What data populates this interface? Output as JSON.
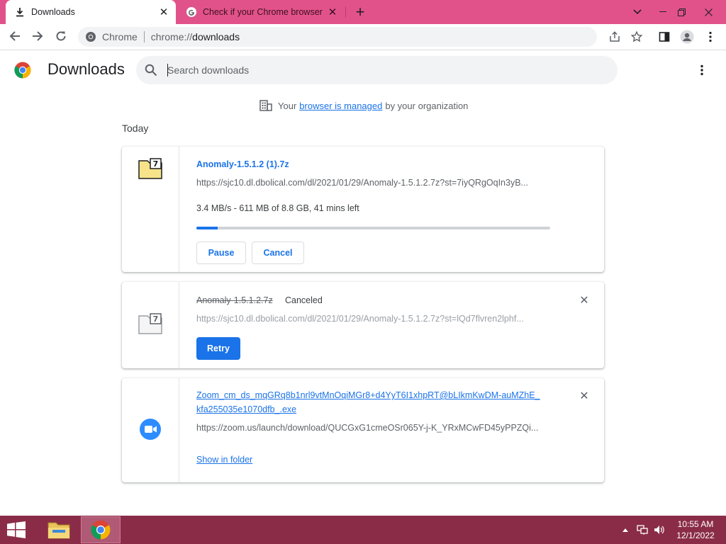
{
  "tabs": [
    {
      "title": "Downloads",
      "icon": "download-icon",
      "active": true
    },
    {
      "title": "Check if your Chrome browser is",
      "icon": "google-icon",
      "active": false
    }
  ],
  "toolbar": {
    "scheme_label": "Chrome",
    "url_prefix": "chrome://",
    "url_host": "downloads"
  },
  "header": {
    "title": "Downloads",
    "search_placeholder": "Search downloads"
  },
  "managed": {
    "prefix": "Your",
    "link": "browser is managed",
    "suffix": "by your organization"
  },
  "day_label": "Today",
  "downloads": [
    {
      "name": "Anomaly-1.5.1.2 (1).7z",
      "url": "https://sjc10.dl.dbolical.com/dl/2021/01/29/Anomaly-1.5.1.2.7z?st=7iyQRgOqIn3yB...",
      "status": "3.4 MB/s - 611 MB of 8.8 GB, 41 mins left",
      "progress": 0.06,
      "pause_label": "Pause",
      "cancel_label": "Cancel"
    },
    {
      "name": "Anomaly-1.5.1.2.7z",
      "tag": "Canceled",
      "url": "https://sjc10.dl.dbolical.com/dl/2021/01/29/Anomaly-1.5.1.2.7z?st=lQd7flvren2lphf...",
      "retry_label": "Retry"
    },
    {
      "name_line1": "Zoom_cm_ds_mqGRq8b1nrl9vtMnOqiMGr8+d4YyT6I1xhpRT@bLIkmKwDM-auMZhE_",
      "name_line2": "kfa255035e1070dfb_.exe",
      "url": "https://zoom.us/launch/download/QUCGxG1cmeOSr065Y-j-K_YRxMCwFD45yPPZQi...",
      "show_label": "Show in folder"
    }
  ],
  "taskbar": {
    "time": "10:55 AM",
    "date": "12/1/2022"
  },
  "colors": {
    "tab_strip": "#e2528a",
    "accent": "#1a73e8",
    "taskbar": "#8a2c48"
  }
}
